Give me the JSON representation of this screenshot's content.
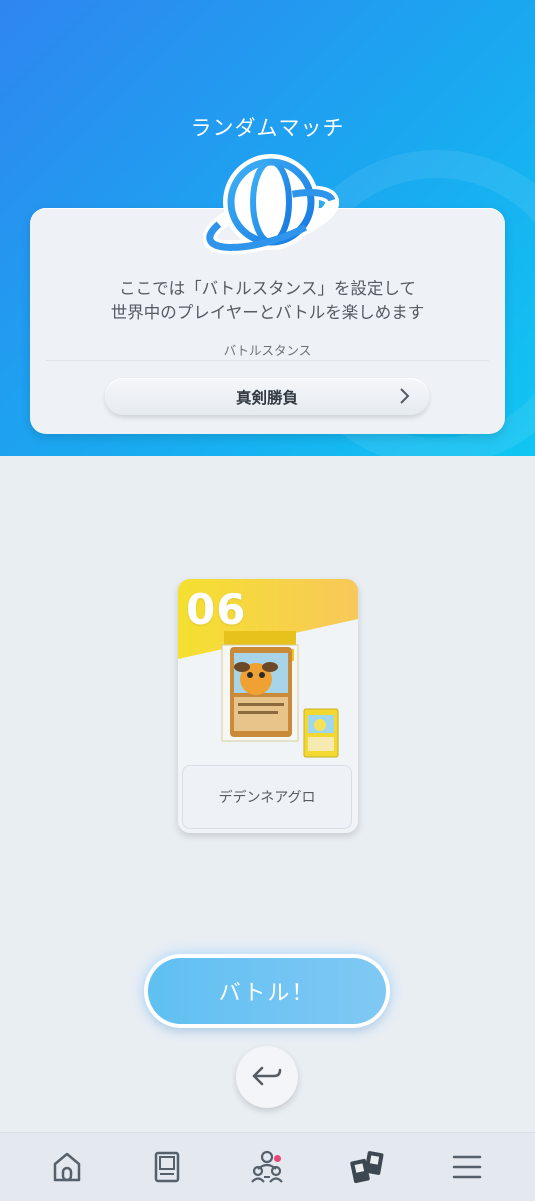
{
  "header": {
    "title": "ランダムマッチ",
    "icon": "globe-icon"
  },
  "info": {
    "description_line1": "ここでは「バトルスタンス」を設定して",
    "description_line2": "世界中のプレイヤーとバトルを楽しめます",
    "stance_label": "バトルスタンス",
    "stance_value": "真剣勝負"
  },
  "deck": {
    "number": "06",
    "name": "デデンネアグロ"
  },
  "actions": {
    "battle_label": "バトル！",
    "back_icon": "back-arrow-icon"
  },
  "nav": {
    "items": [
      {
        "icon": "home-icon"
      },
      {
        "icon": "card-binder-icon"
      },
      {
        "icon": "social-icon",
        "notification": true
      },
      {
        "icon": "battle-icon",
        "active": true
      },
      {
        "icon": "menu-icon"
      }
    ]
  },
  "colors": {
    "header_start": "#2f86f0",
    "header_end": "#10c6f2",
    "battle_button": "#6cc4f3",
    "notification": "#e8467a",
    "deck_banner": "#f6d64a"
  }
}
